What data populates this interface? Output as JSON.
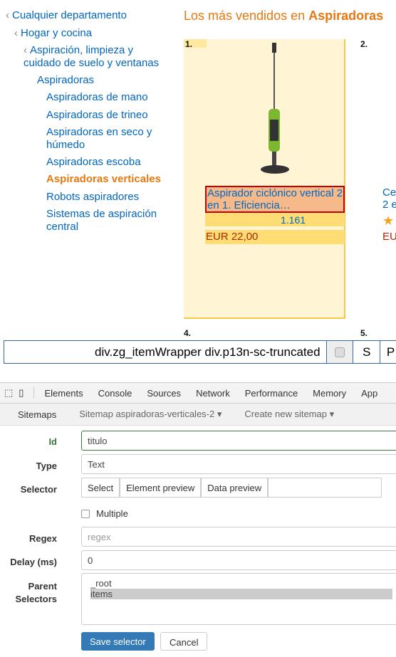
{
  "categories": [
    {
      "label": "Cualquier departamento",
      "chevron": "‹"
    },
    {
      "label": "Hogar y cocina",
      "chevron": "‹"
    },
    {
      "label": "Aspiración, limpieza y",
      "label2": "cuidado de suelo y ventanas",
      "chevron": "‹"
    },
    {
      "label": "Aspiradoras"
    },
    {
      "label": "Aspiradoras de mano"
    },
    {
      "label": "Aspiradoras de trineo"
    },
    {
      "label": "Aspiradoras en seco y",
      "label2": "húmedo"
    },
    {
      "label": "Aspiradoras escoba"
    },
    {
      "label": "Aspiradoras verticales",
      "selected": true
    },
    {
      "label": "Robots aspiradores"
    },
    {
      "label": "Sistemas de aspiración",
      "label2": "central"
    }
  ],
  "heading": {
    "prefix": "Los más vendidos en ",
    "category": "Aspiradoras"
  },
  "products": [
    {
      "rank": "1.",
      "title": "Aspirador ciclónico vertical 2 en 1. Eficiencia…",
      "reviews": "1.161",
      "price": "EUR 22,00"
    },
    {
      "rank": "2.",
      "title_partial": "Ce",
      "title_partial2": "2 e",
      "price_partial": "EU"
    },
    {
      "rank": "4."
    },
    {
      "rank": "5."
    }
  ],
  "selector_bar": {
    "selector": "div.zg_itemWrapper div.p13n-sc-truncated",
    "s": "S",
    "p": "P"
  },
  "devtools": {
    "tabs": [
      "Elements",
      "Console",
      "Sources",
      "Network",
      "Performance",
      "Memory",
      "App"
    ]
  },
  "sitemap_nav": {
    "sitemaps": "Sitemaps",
    "current": "Sitemap aspiradoras-verticales-2",
    "create": "Create new sitemap"
  },
  "form": {
    "id_label": "Id",
    "id_value": "titulo",
    "type_label": "Type",
    "type_value": "Text",
    "selector_label": "Selector",
    "select_btn": "Select",
    "element_preview_btn": "Element preview",
    "data_preview_btn": "Data preview",
    "multiple_label": "Multiple",
    "regex_label": "Regex",
    "regex_placeholder": "regex",
    "delay_label": "Delay (ms)",
    "delay_value": "0",
    "parent_label1": "Parent",
    "parent_label2": "Selectors",
    "parents": [
      "_root",
      "items"
    ],
    "save": "Save selector",
    "cancel": "Cancel"
  },
  "colors": {
    "link": "#0066c0",
    "accent": "#e47911",
    "primary_button": "#337ab7"
  }
}
